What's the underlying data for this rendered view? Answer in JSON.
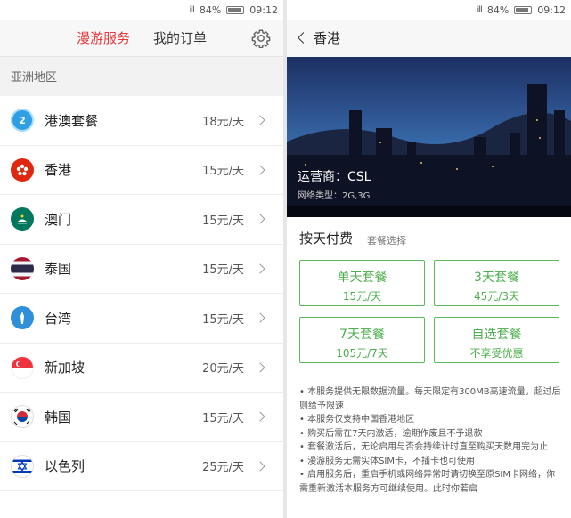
{
  "status": {
    "battery": "84%",
    "time": "09:12",
    "signal": "ill"
  },
  "left": {
    "tabs": {
      "roaming": "漫游服务",
      "orders": "我的订单"
    },
    "region": "亚洲地区",
    "items": [
      {
        "name": "港澳套餐",
        "price": "18元/天",
        "flag": "hk-macau",
        "badge": "2"
      },
      {
        "name": "香港",
        "price": "15元/天",
        "flag": "hong-kong"
      },
      {
        "name": "澳门",
        "price": "15元/天",
        "flag": "macau"
      },
      {
        "name": "泰国",
        "price": "15元/天",
        "flag": "thailand"
      },
      {
        "name": "台湾",
        "price": "15元/天",
        "flag": "taiwan"
      },
      {
        "name": "新加坡",
        "price": "20元/天",
        "flag": "singapore"
      },
      {
        "name": "韩国",
        "price": "15元/天",
        "flag": "korea"
      },
      {
        "name": "以色列",
        "price": "25元/天",
        "flag": "israel"
      }
    ]
  },
  "right": {
    "title": "香港",
    "operator": "运营商：CSL",
    "network": "网络类型：2G,3G",
    "section_title": "按天付费",
    "section_sub": "套餐选择",
    "packages": [
      {
        "name": "单天套餐",
        "price": "15元/天"
      },
      {
        "name": "3天套餐",
        "price": "45元/3天"
      },
      {
        "name": "7天套餐",
        "price": "105元/7天"
      },
      {
        "name": "自选套餐",
        "price": "不享受优惠"
      }
    ],
    "notes": [
      "• 本服务提供无限数据流量。每天限定有300MB高速流量，超过后则给予限速",
      "• 本服务仅支持中国香港地区",
      "• 购买后需在7天内激活，逾期作废且不予退款",
      "• 套餐激活后，无论启用与否会持续计时直至购买天数用完为止",
      "• 漫游服务无需实体SIM卡，不插卡也可使用",
      "• 启用服务后，重启手机或网络异常时请切换至原SIM卡网络，你需重新激活本服务方可继续使用。此时你若启"
    ]
  },
  "colors": {
    "accent": "#e4393c",
    "green": "#4cae4c"
  }
}
